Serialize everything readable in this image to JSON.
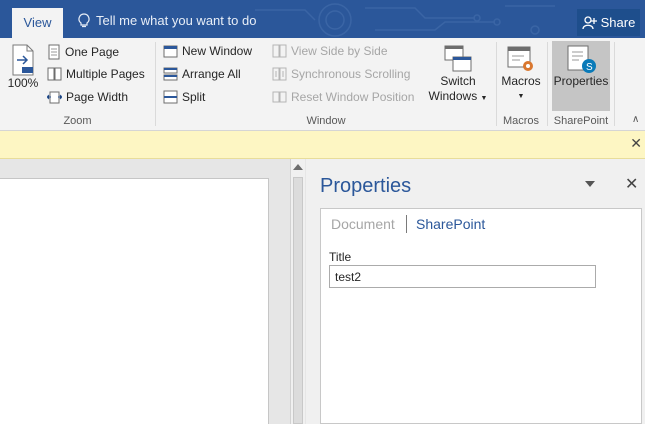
{
  "tabs": {
    "active_label": "View"
  },
  "tell_me": {
    "text": "Tell me what you want to do"
  },
  "share": {
    "label": "Share"
  },
  "ribbon": {
    "zoom": {
      "zoom_100_label": "100%",
      "one_page": "One Page",
      "multiple_pages": "Multiple Pages",
      "page_width": "Page Width",
      "group_label": "Zoom"
    },
    "window": {
      "new_window": "New Window",
      "arrange_all": "Arrange All",
      "split": "Split",
      "view_side_by_side": "View Side by Side",
      "synchronous_scrolling": "Synchronous Scrolling",
      "reset_window_position": "Reset Window Position",
      "switch_windows_line1": "Switch",
      "switch_windows_line2": "Windows",
      "group_label": "Window"
    },
    "macros": {
      "label": "Macros",
      "group_label": "Macros"
    },
    "sharepoint": {
      "label": "Properties",
      "group_label": "SharePoint"
    }
  },
  "pane": {
    "title": "Properties",
    "tabs": [
      "Document",
      "SharePoint"
    ],
    "field_label": "Title",
    "field_value": "test2"
  },
  "colors": {
    "brand": "#2b579a",
    "infobar": "#fdf6c3"
  }
}
